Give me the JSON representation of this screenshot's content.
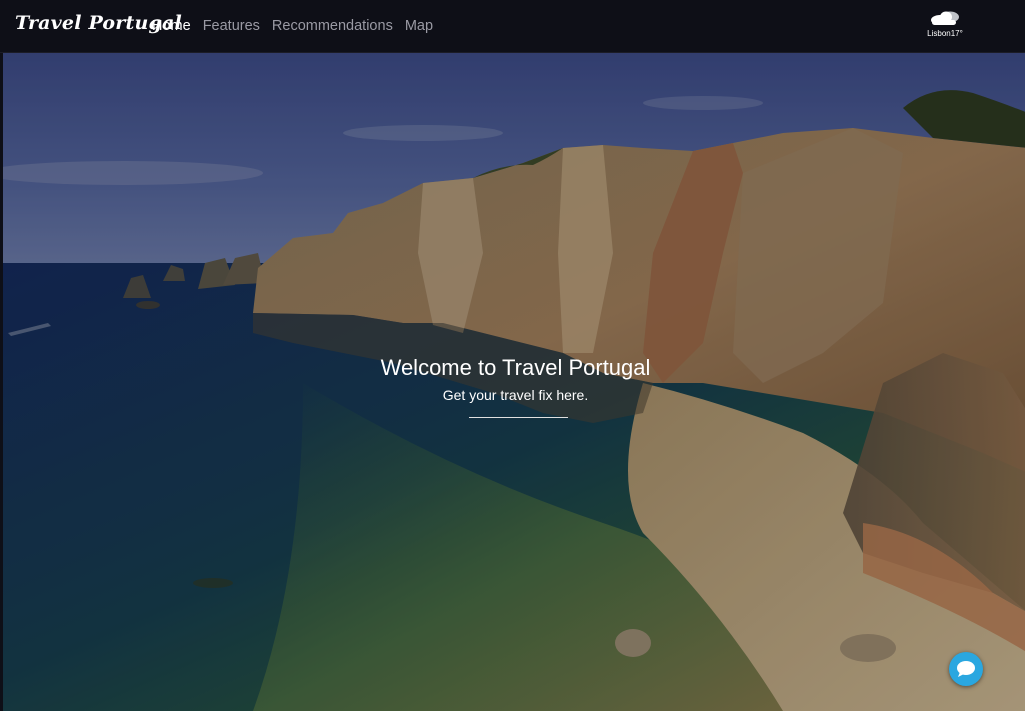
{
  "navbar": {
    "brand": "Travel Portugal",
    "links": [
      {
        "label": "Home",
        "active": true
      },
      {
        "label": "Features",
        "active": false
      },
      {
        "label": "Recommendations",
        "active": false
      },
      {
        "label": "Map",
        "active": false
      }
    ],
    "weather": {
      "icon": "cloud-icon",
      "text": "Lisbon17°"
    }
  },
  "hero": {
    "title": "Welcome to Travel Portugal",
    "subtitle": "Get your travel fix here."
  },
  "chat": {
    "icon": "chat-bubble-icon",
    "color": "#2aa7e0"
  },
  "colors": {
    "navbar_bg": "#0e0f17",
    "nav_link": "#9a9aa4",
    "nav_link_active": "#ffffff"
  }
}
